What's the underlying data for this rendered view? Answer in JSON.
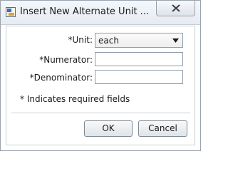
{
  "window": {
    "title": "Insert New Alternate Unit ...",
    "app_icon": "dialog-app-icon",
    "close_icon": "close-icon"
  },
  "form": {
    "unit_label": "*Unit:",
    "unit_value": "each",
    "numerator_label": "*Numerator:",
    "numerator_value": "",
    "denominator_label": "*Denominator:",
    "denominator_value": ""
  },
  "note": "* Indicates required fields",
  "buttons": {
    "ok": "OK",
    "cancel": "Cancel"
  }
}
